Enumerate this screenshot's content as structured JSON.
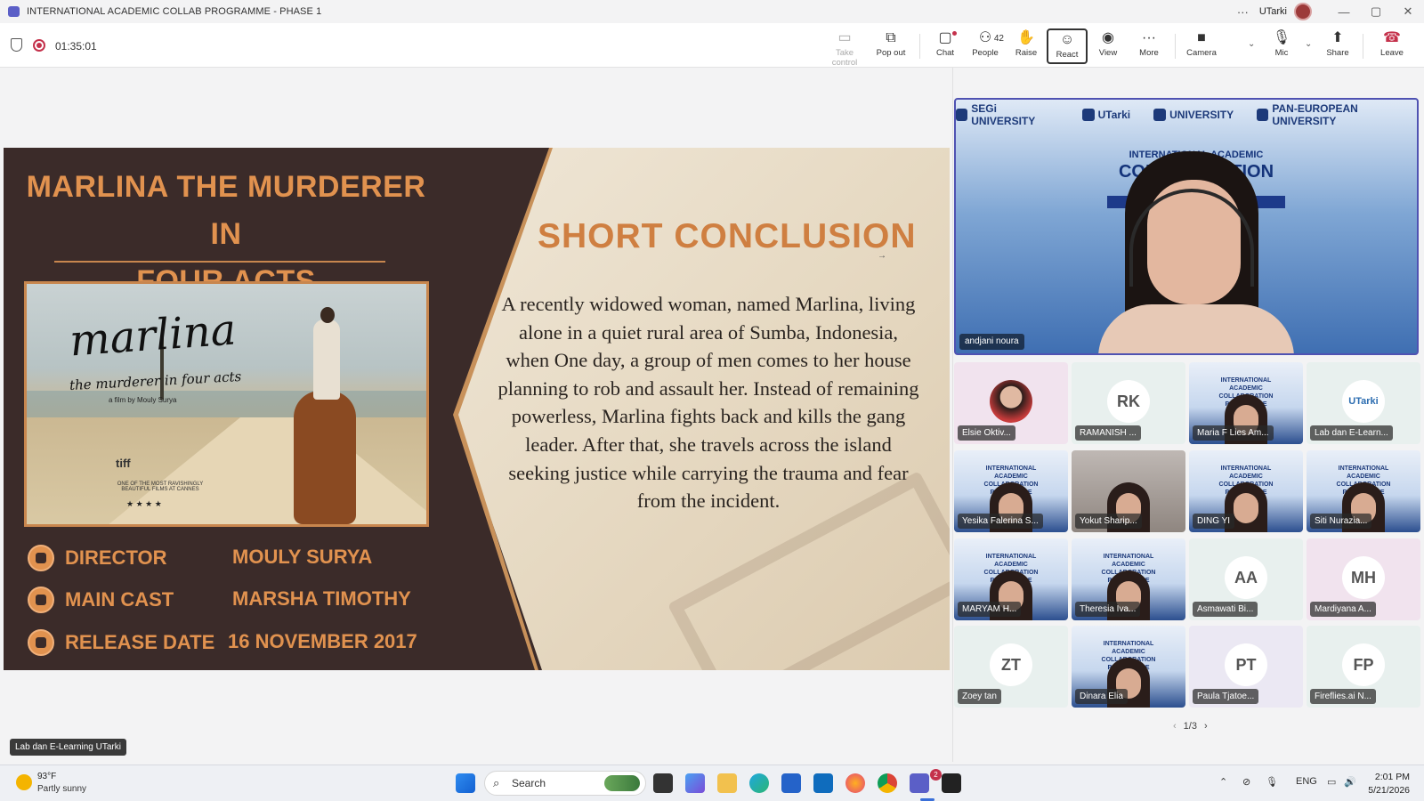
{
  "window": {
    "title": "INTERNATIONAL ACADEMIC COLLAB PROGRAMME - PHASE 1",
    "user": "UTarki",
    "min": "—",
    "max": "▢",
    "close": "✕",
    "more": "···"
  },
  "meeting": {
    "timer": "01:35:01",
    "people_count": "42",
    "toolbar": {
      "take_control": "Take control",
      "pop_out": "Pop out",
      "chat": "Chat",
      "people": "People",
      "raise": "Raise",
      "react": "React",
      "view": "View",
      "more": "More",
      "camera": "Camera",
      "mic": "Mic",
      "share": "Share",
      "leave": "Leave"
    }
  },
  "slide": {
    "film_title_1": "MARLINA THE MURDERER IN",
    "film_title_2": "FOUR ACTS",
    "poster": {
      "title": "marlina",
      "subtitle": "the murderer in four acts",
      "byline": "a film by Mouly Surya",
      "festival": "tiff",
      "quote": "ONE OF THE MOST RAVISHINGLY BEAUTIFUL FILMS AT CANNES",
      "stars": "★ ★ ★ ★"
    },
    "director_label": "DIRECTOR",
    "director": "MOULY SURYA",
    "cast_label": "MAIN CAST",
    "cast": "MARSHA TIMOTHY",
    "release_label": "RELEASE DATE",
    "release": "16 NOVEMBER 2017",
    "conclusion_title": "SHORT CONCLUSION",
    "conclusion": "A recently widowed woman, named Marlina, living alone in a quiet rural area of Sumba, Indonesia, when One day, a group of men comes to her house planning to rob and assault her. Instead of remaining powerless, Marlina fights back and kills the gang leader. After that, she travels across the island seeking justice while carrying the trauma and fear from the incident."
  },
  "main_video": {
    "name": "andjani noura",
    "logos": [
      "SEGi UNIVERSITY",
      "UTarki",
      "UNIVERSITY",
      "PAN-EUROPEAN UNIVERSITY"
    ],
    "banner_small": "INTERNATIONAL ACADEMIC",
    "banner_big": "COLLABORATION"
  },
  "participants": [
    {
      "name": "Elsie Oktiv...",
      "type": "pic"
    },
    {
      "name": "RAMANISH ...",
      "initials": "RK"
    },
    {
      "name": "Maria F Lies Am...",
      "type": "video"
    },
    {
      "name": "Lab dan E-Learn...",
      "type": "ut",
      "initials": "UTarki"
    },
    {
      "name": "Yesika Falerina S...",
      "type": "video"
    },
    {
      "name": "Yokut Sharip...",
      "type": "photo"
    },
    {
      "name": "DING YI",
      "type": "video"
    },
    {
      "name": "Siti Nurazia...",
      "type": "video"
    },
    {
      "name": "MARYAM H...",
      "type": "video"
    },
    {
      "name": "Theresia Iva...",
      "type": "video"
    },
    {
      "name": "Asmawati Bi...",
      "initials": "AA"
    },
    {
      "name": "Mardiyana A...",
      "initials": "MH"
    },
    {
      "name": "Zoey tan",
      "initials": "ZT"
    },
    {
      "name": "Dinara Elia",
      "type": "video"
    },
    {
      "name": "Paula Tjatoe...",
      "initials": "PT"
    },
    {
      "name": "Fireflies.ai N...",
      "initials": "FP"
    }
  ],
  "tile_banner": "INTERNATIONAL ACADEMIC COLLABORATION PROGRAMME",
  "pager": {
    "text": "1/3",
    "prev": "‹",
    "next": "›"
  },
  "self_view_name": "Lab dan E-Learning UTarki",
  "taskbar": {
    "temp": "93°F",
    "condition": "Partly sunny",
    "search": "Search",
    "teams_badge": "2",
    "lang": "ENG",
    "time": "2:01 PM",
    "date": "5/21/2026"
  }
}
